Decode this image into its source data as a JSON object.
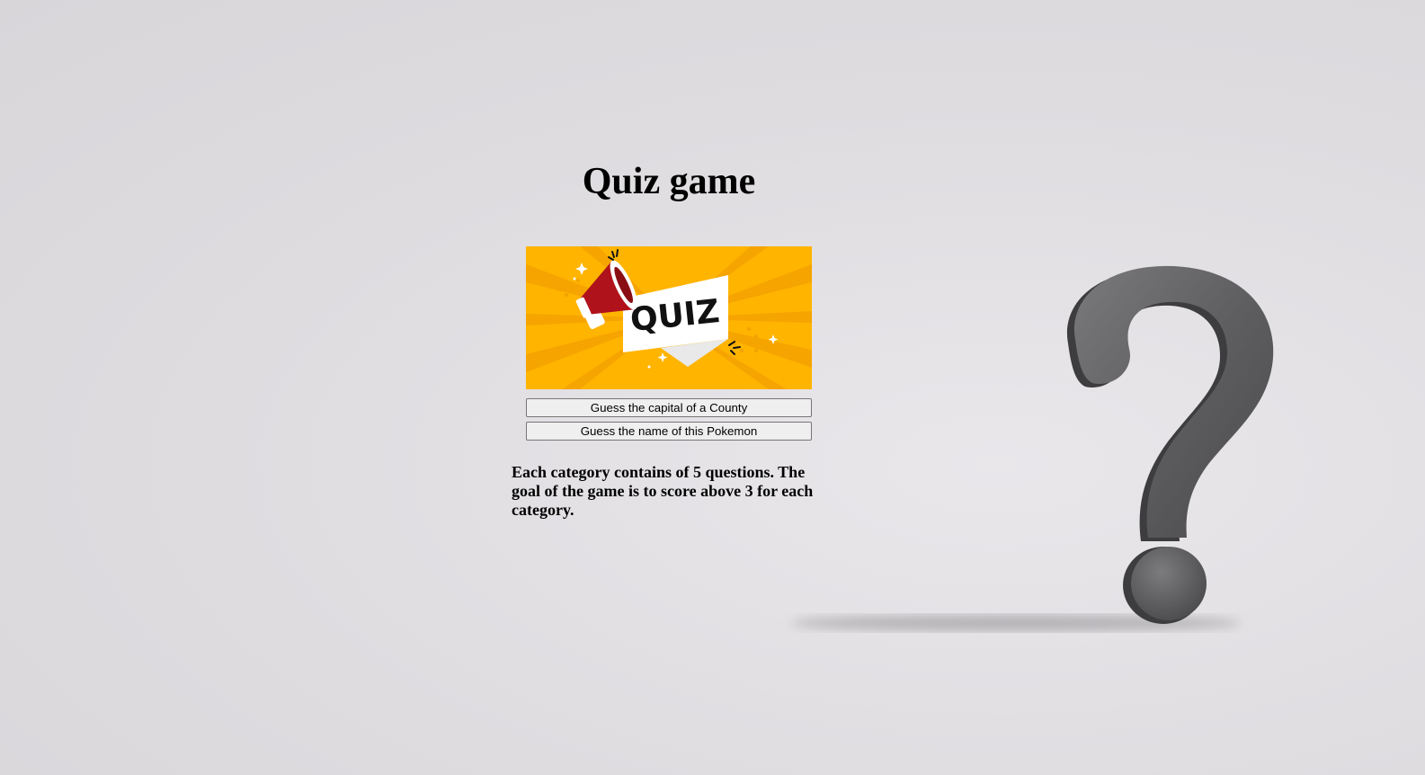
{
  "page": {
    "title": "Quiz game",
    "banner_text": "QUIZ",
    "description": "Each category contains of 5 questions. The goal of the game is to score above 3 for each category."
  },
  "categories": [
    {
      "label": "Guess the capital of a County"
    },
    {
      "label": "Guess the name of this Pokemon"
    }
  ],
  "icons": {
    "banner_icon": "megaphone-icon",
    "background_decoration": "question-mark-icon"
  },
  "colors": {
    "banner_background": "#FFB400",
    "megaphone_red": "#B0121B",
    "question_mark_gray": "#5f5f61",
    "page_background": "#dedcdf"
  }
}
